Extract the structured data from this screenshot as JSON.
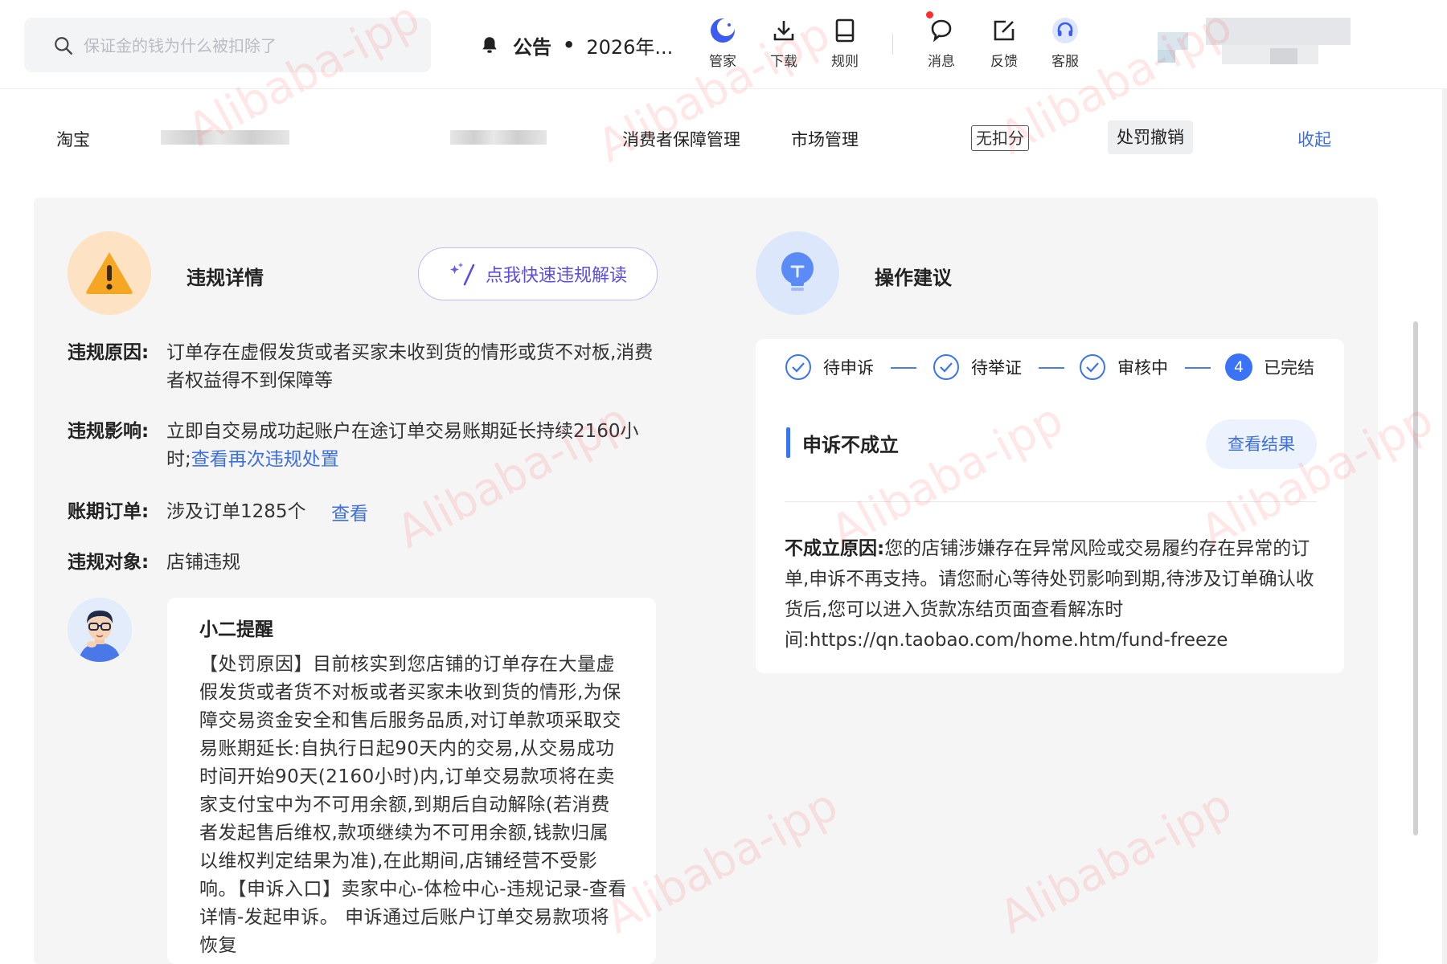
{
  "header": {
    "search_placeholder": "保证金的钱为什么被扣除了",
    "notice_label": "公告",
    "notice_dot": "•",
    "notice_text": "2026年...",
    "tools": [
      {
        "label": "管家",
        "icon": "moon-icon"
      },
      {
        "label": "下载",
        "icon": "download-icon"
      },
      {
        "label": "规则",
        "icon": "book-icon"
      },
      {
        "label": "消息",
        "icon": "message-icon"
      },
      {
        "label": "反馈",
        "icon": "edit-icon"
      },
      {
        "label": "客服",
        "icon": "headset-icon"
      }
    ]
  },
  "subnav": {
    "taobao": "淘宝",
    "consumer_protection": "消费者保障管理",
    "market": "市场管理",
    "no_deduction": "无扣分",
    "penalty_revoke": "处罚撤销",
    "collapse": "收起"
  },
  "violation": {
    "title": "违规详情",
    "ai_button": "点我快速违规解读",
    "reason_label": "违规原因:",
    "reason_value": "订单存在虚假发货或者买家未收到货的情形或货不对板,消费者权益得不到保障等",
    "impact_label": "违规影响:",
    "impact_value": "立即自交易成功起账户在途订单交易账期延长持续2160小时;",
    "impact_link": "查看再次违规处置",
    "orders_label": "账期订单:",
    "orders_value": "涉及订单1285个",
    "orders_link": "查看",
    "target_label": "违规对象:",
    "target_value": "店铺违规"
  },
  "tip": {
    "title": "小二提醒",
    "body": "【处罚原因】目前核实到您店铺的订单存在大量虚假发货或者货不对板或者买家未收到货的情形,为保障交易资金安全和售后服务品质,对订单款项采取交易账期延长:自执行日起90天内的交易,从交易成功时间开始90天(2160小时)内,订单交易款项将在卖家支付宝中为不可用余额,到期后自动解除(若消费者发起售后维权,款项继续为不可用余额,钱款归属以维权判定结果为准),在此期间,店铺经营不受影响。【申诉入口】卖家中心-体检中心-违规记录-查看详情-发起申诉。 申诉通过后账户订单交易款项将恢复"
  },
  "advice": {
    "title": "操作建议",
    "steps": [
      "待申诉",
      "待举证",
      "审核中",
      "已完结"
    ],
    "current_step_number": "4",
    "status": "申诉不成立",
    "result_button": "查看结果",
    "reason_label": "不成立原因:",
    "reason_value": "您的店铺涉嫌存在异常风险或交易履约存在异常的订单,申诉不再支持。请您耐心等待处罚影响到期,待涉及订单确认收货后,您可以进入货款冻结页面查看解冻时间:https://qn.taobao.com/home.htm/fund-freeze"
  },
  "watermark": "Alibaba-ipp",
  "colors": {
    "accent": "#3a73f5",
    "link": "#3d6fe0",
    "warning": "#f5a623",
    "ai_purple": "#5b4de0"
  }
}
